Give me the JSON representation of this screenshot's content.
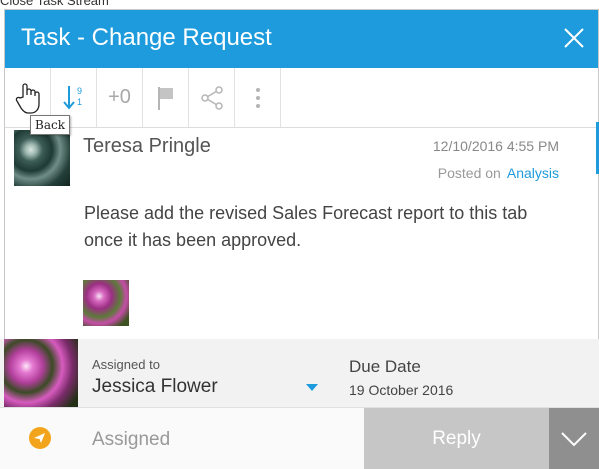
{
  "caption": "Close Task Stream",
  "header": {
    "title": "Task - Change Request"
  },
  "toolbar": {
    "back_tooltip": "Back",
    "counter_top": "9",
    "counter_bottom": "1",
    "plus_label": "+0"
  },
  "post": {
    "author": "Teresa Pringle",
    "date": "12/10/2016 4:55 PM",
    "posted_on_label": "Posted on",
    "posted_on_link": "Analysis",
    "text": "Please add the revised Sales Forecast report to this tab once it has been approved."
  },
  "assignment": {
    "assigned_label": "Assigned to",
    "assignee": "Jessica Flower",
    "due_label": "Due Date",
    "due_value": "19 October 2016"
  },
  "footer": {
    "status": "Assigned",
    "reply_label": "Reply"
  },
  "colors": {
    "accent": "#1e9bdc",
    "status_orange": "#f2a51c"
  }
}
